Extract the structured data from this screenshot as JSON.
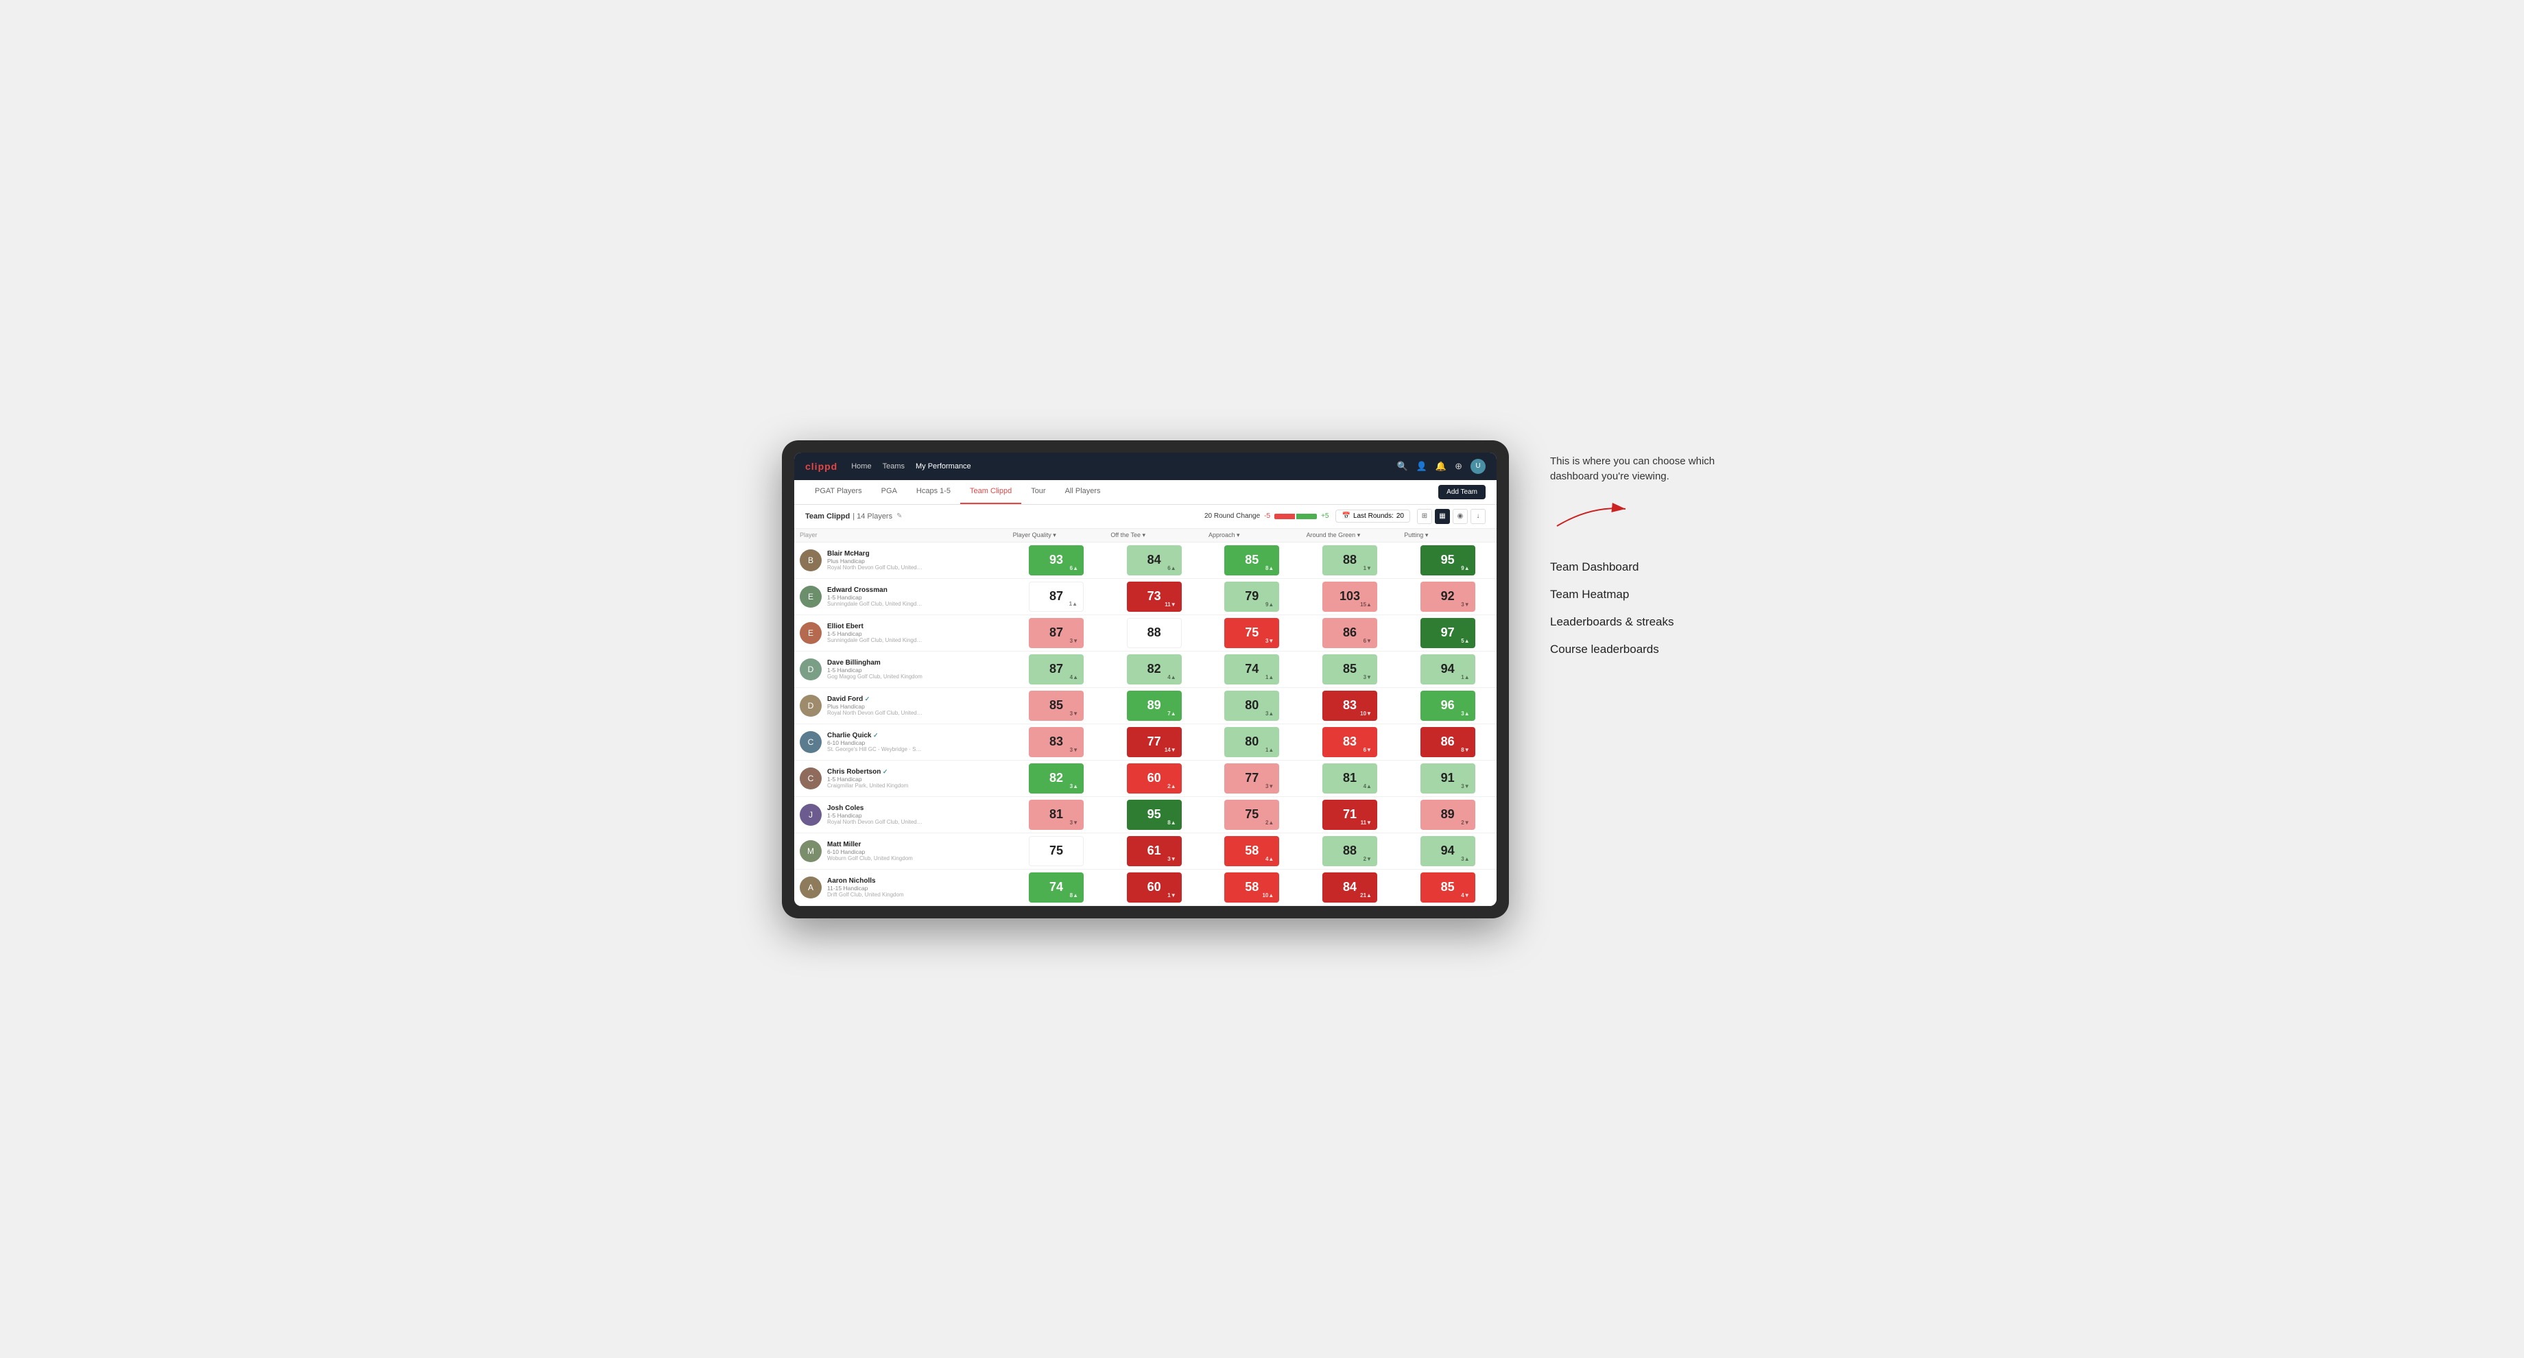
{
  "annotation": {
    "intro_text": "This is where you can choose which dashboard you're viewing.",
    "items": [
      {
        "label": "Team Dashboard"
      },
      {
        "label": "Team Heatmap"
      },
      {
        "label": "Leaderboards & streaks"
      },
      {
        "label": "Course leaderboards"
      }
    ]
  },
  "navbar": {
    "logo": "clippd",
    "nav_items": [
      {
        "label": "Home",
        "active": false
      },
      {
        "label": "Teams",
        "active": false
      },
      {
        "label": "My Performance",
        "active": true
      }
    ],
    "icons": [
      "search",
      "user",
      "bell",
      "settings",
      "avatar"
    ]
  },
  "subnav": {
    "tabs": [
      {
        "label": "PGAT Players",
        "active": false
      },
      {
        "label": "PGA",
        "active": false
      },
      {
        "label": "Hcaps 1-5",
        "active": false
      },
      {
        "label": "Team Clippd",
        "active": true
      },
      {
        "label": "Tour",
        "active": false
      },
      {
        "label": "All Players",
        "active": false
      }
    ],
    "add_team_label": "Add Team"
  },
  "team_header": {
    "name": "Team Clippd",
    "separator": "|",
    "count": "14 Players",
    "round_change_label": "20 Round Change",
    "round_change_neg": "-5",
    "round_change_pos": "+5",
    "last_rounds_label": "Last Rounds:",
    "last_rounds_value": "20"
  },
  "table": {
    "columns": [
      {
        "label": "Player Quality ▾"
      },
      {
        "label": "Off the Tee ▾"
      },
      {
        "label": "Approach ▾"
      },
      {
        "label": "Around the Green ▾"
      },
      {
        "label": "Putting ▾"
      }
    ],
    "rows": [
      {
        "name": "Blair McHarg",
        "handicap": "Plus Handicap",
        "club": "Royal North Devon Golf Club, United Kingdom",
        "verified": false,
        "avatar_color": "#8B7355",
        "avatar_letter": "B",
        "scores": [
          {
            "value": "93",
            "change": "6▲",
            "change_dir": "up",
            "bg": "green-mid"
          },
          {
            "value": "84",
            "change": "6▲",
            "change_dir": "up",
            "bg": "green-light"
          },
          {
            "value": "85",
            "change": "8▲",
            "change_dir": "up",
            "bg": "green-mid"
          },
          {
            "value": "88",
            "change": "1▼",
            "change_dir": "down",
            "bg": "green-light"
          },
          {
            "value": "95",
            "change": "9▲",
            "change_dir": "up",
            "bg": "green-dark"
          }
        ]
      },
      {
        "name": "Edward Crossman",
        "handicap": "1-5 Handicap",
        "club": "Sunningdale Golf Club, United Kingdom",
        "verified": false,
        "avatar_color": "#6B8E6B",
        "avatar_letter": "E",
        "scores": [
          {
            "value": "87",
            "change": "1▲",
            "change_dir": "up",
            "bg": "white"
          },
          {
            "value": "73",
            "change": "11▼",
            "change_dir": "down",
            "bg": "red-dark"
          },
          {
            "value": "79",
            "change": "9▲",
            "change_dir": "up",
            "bg": "green-light"
          },
          {
            "value": "103",
            "change": "15▲",
            "change_dir": "up",
            "bg": "red-light"
          },
          {
            "value": "92",
            "change": "3▼",
            "change_dir": "down",
            "bg": "red-light"
          }
        ]
      },
      {
        "name": "Elliot Ebert",
        "handicap": "1-5 Handicap",
        "club": "Sunningdale Golf Club, United Kingdom",
        "verified": false,
        "avatar_color": "#B5694E",
        "avatar_letter": "E",
        "scores": [
          {
            "value": "87",
            "change": "3▼",
            "change_dir": "down",
            "bg": "red-light"
          },
          {
            "value": "88",
            "change": "",
            "change_dir": "neutral",
            "bg": "white"
          },
          {
            "value": "75",
            "change": "3▼",
            "change_dir": "down",
            "bg": "red-mid"
          },
          {
            "value": "86",
            "change": "6▼",
            "change_dir": "down",
            "bg": "red-light"
          },
          {
            "value": "97",
            "change": "5▲",
            "change_dir": "up",
            "bg": "green-dark"
          }
        ]
      },
      {
        "name": "Dave Billingham",
        "handicap": "1-5 Handicap",
        "club": "Gog Magog Golf Club, United Kingdom",
        "verified": false,
        "avatar_color": "#7B9E87",
        "avatar_letter": "D",
        "scores": [
          {
            "value": "87",
            "change": "4▲",
            "change_dir": "up",
            "bg": "green-light"
          },
          {
            "value": "82",
            "change": "4▲",
            "change_dir": "up",
            "bg": "green-light"
          },
          {
            "value": "74",
            "change": "1▲",
            "change_dir": "up",
            "bg": "green-light"
          },
          {
            "value": "85",
            "change": "3▼",
            "change_dir": "down",
            "bg": "green-light"
          },
          {
            "value": "94",
            "change": "1▲",
            "change_dir": "up",
            "bg": "green-light"
          }
        ]
      },
      {
        "name": "David Ford",
        "handicap": "Plus Handicap",
        "club": "Royal North Devon Golf Club, United Kingdom",
        "verified": true,
        "avatar_color": "#9E8B6B",
        "avatar_letter": "D",
        "scores": [
          {
            "value": "85",
            "change": "3▼",
            "change_dir": "down",
            "bg": "red-light"
          },
          {
            "value": "89",
            "change": "7▲",
            "change_dir": "up",
            "bg": "green-mid"
          },
          {
            "value": "80",
            "change": "3▲",
            "change_dir": "up",
            "bg": "green-light"
          },
          {
            "value": "83",
            "change": "10▼",
            "change_dir": "down",
            "bg": "red-dark"
          },
          {
            "value": "96",
            "change": "3▲",
            "change_dir": "up",
            "bg": "green-mid"
          }
        ]
      },
      {
        "name": "Charlie Quick",
        "handicap": "6-10 Handicap",
        "club": "St. George's Hill GC - Weybridge · Surrey, Uni...",
        "verified": true,
        "avatar_color": "#5B7B8E",
        "avatar_letter": "C",
        "scores": [
          {
            "value": "83",
            "change": "3▼",
            "change_dir": "down",
            "bg": "red-light"
          },
          {
            "value": "77",
            "change": "14▼",
            "change_dir": "down",
            "bg": "red-dark"
          },
          {
            "value": "80",
            "change": "1▲",
            "change_dir": "up",
            "bg": "green-light"
          },
          {
            "value": "83",
            "change": "6▼",
            "change_dir": "down",
            "bg": "red-mid"
          },
          {
            "value": "86",
            "change": "8▼",
            "change_dir": "down",
            "bg": "red-dark"
          }
        ]
      },
      {
        "name": "Chris Robertson",
        "handicap": "1-5 Handicap",
        "club": "Craigmillar Park, United Kingdom",
        "verified": true,
        "avatar_color": "#8E6B5B",
        "avatar_letter": "C",
        "scores": [
          {
            "value": "82",
            "change": "3▲",
            "change_dir": "up",
            "bg": "green-mid"
          },
          {
            "value": "60",
            "change": "2▲",
            "change_dir": "up",
            "bg": "red-mid"
          },
          {
            "value": "77",
            "change": "3▼",
            "change_dir": "down",
            "bg": "red-light"
          },
          {
            "value": "81",
            "change": "4▲",
            "change_dir": "up",
            "bg": "green-light"
          },
          {
            "value": "91",
            "change": "3▼",
            "change_dir": "down",
            "bg": "green-light"
          }
        ]
      },
      {
        "name": "Josh Coles",
        "handicap": "1-5 Handicap",
        "club": "Royal North Devon Golf Club, United Kingdom",
        "verified": false,
        "avatar_color": "#6B5B8E",
        "avatar_letter": "J",
        "scores": [
          {
            "value": "81",
            "change": "3▼",
            "change_dir": "down",
            "bg": "red-light"
          },
          {
            "value": "95",
            "change": "8▲",
            "change_dir": "up",
            "bg": "green-dark"
          },
          {
            "value": "75",
            "change": "2▲",
            "change_dir": "up",
            "bg": "red-light"
          },
          {
            "value": "71",
            "change": "11▼",
            "change_dir": "down",
            "bg": "red-dark"
          },
          {
            "value": "89",
            "change": "2▼",
            "change_dir": "down",
            "bg": "red-light"
          }
        ]
      },
      {
        "name": "Matt Miller",
        "handicap": "6-10 Handicap",
        "club": "Woburn Golf Club, United Kingdom",
        "verified": false,
        "avatar_color": "#7B8E6B",
        "avatar_letter": "M",
        "scores": [
          {
            "value": "75",
            "change": "",
            "change_dir": "neutral",
            "bg": "white"
          },
          {
            "value": "61",
            "change": "3▼",
            "change_dir": "down",
            "bg": "red-dark"
          },
          {
            "value": "58",
            "change": "4▲",
            "change_dir": "up",
            "bg": "red-mid"
          },
          {
            "value": "88",
            "change": "2▼",
            "change_dir": "down",
            "bg": "green-light"
          },
          {
            "value": "94",
            "change": "3▲",
            "change_dir": "up",
            "bg": "green-light"
          }
        ]
      },
      {
        "name": "Aaron Nicholls",
        "handicap": "11-15 Handicap",
        "club": "Drift Golf Club, United Kingdom",
        "verified": false,
        "avatar_color": "#8E7B5B",
        "avatar_letter": "A",
        "scores": [
          {
            "value": "74",
            "change": "8▲",
            "change_dir": "up",
            "bg": "green-mid"
          },
          {
            "value": "60",
            "change": "1▼",
            "change_dir": "down",
            "bg": "red-dark"
          },
          {
            "value": "58",
            "change": "10▲",
            "change_dir": "up",
            "bg": "red-mid"
          },
          {
            "value": "84",
            "change": "21▲",
            "change_dir": "up",
            "bg": "red-dark"
          },
          {
            "value": "85",
            "change": "4▼",
            "change_dir": "down",
            "bg": "red-mid"
          }
        ]
      }
    ]
  }
}
